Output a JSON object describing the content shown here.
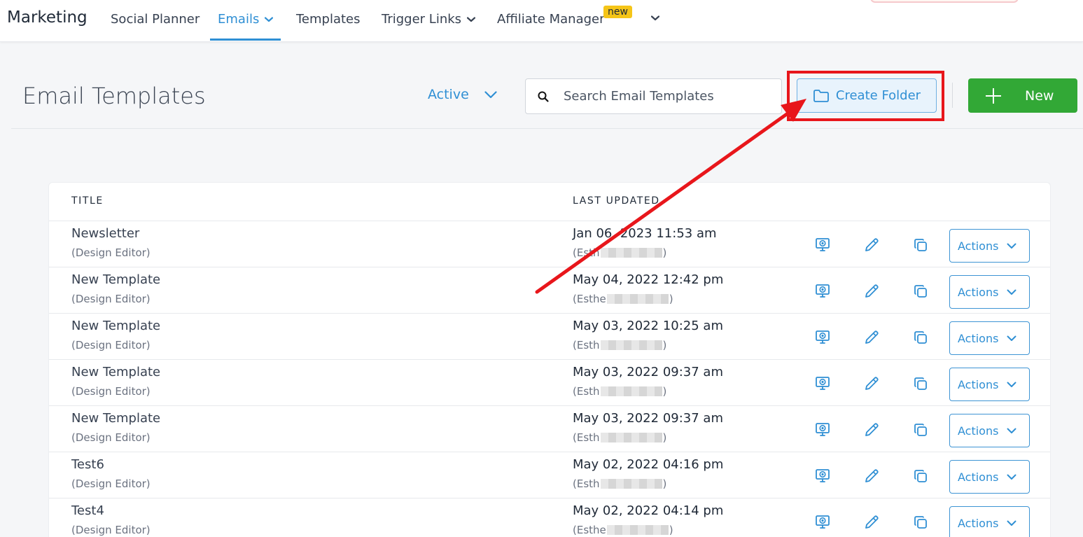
{
  "header": {
    "brand": "Marketing",
    "nav": [
      {
        "label": "Social Planner",
        "active": false,
        "has_dropdown": false
      },
      {
        "label": "Emails",
        "active": true,
        "has_dropdown": true
      },
      {
        "label": "Templates",
        "active": false,
        "has_dropdown": false
      },
      {
        "label": "Trigger Links",
        "active": false,
        "has_dropdown": true
      },
      {
        "label": "Affiliate Manager",
        "active": false,
        "has_dropdown": false
      }
    ],
    "new_badge": "new",
    "more_icon": "chevron-down-icon"
  },
  "toolbar": {
    "page_title": "Email Templates",
    "status_filter": "Active",
    "search_placeholder": "Search Email Templates",
    "create_folder_label": "Create Folder",
    "new_label": "New"
  },
  "table": {
    "columns": [
      "TITLE",
      "LAST UPDATED"
    ],
    "rows": [
      {
        "title": "Newsletter",
        "editor": "(Design Editor)",
        "updated": "Jan 06, 2023 11:53 am",
        "by_prefix": "(Esth",
        "by_suffix": ")"
      },
      {
        "title": "New Template",
        "editor": "(Design Editor)",
        "updated": "May 04, 2022 12:42 pm",
        "by_prefix": "(Esthe",
        "by_suffix": ")"
      },
      {
        "title": "New Template",
        "editor": "(Design Editor)",
        "updated": "May 03, 2022 10:25 am",
        "by_prefix": "(Esth",
        "by_suffix": ")"
      },
      {
        "title": "New Template",
        "editor": "(Design Editor)",
        "updated": "May 03, 2022 09:37 am",
        "by_prefix": "(Esth",
        "by_suffix": ")"
      },
      {
        "title": "New Template",
        "editor": "(Design Editor)",
        "updated": "May 03, 2022 09:37 am",
        "by_prefix": "(Esth",
        "by_suffix": ")"
      },
      {
        "title": "Test6",
        "editor": "(Design Editor)",
        "updated": "May 02, 2022 04:16 pm",
        "by_prefix": "(Esth",
        "by_suffix": ")"
      },
      {
        "title": "Test4",
        "editor": "(Design Editor)",
        "updated": "May 02, 2022 04:14 pm",
        "by_prefix": "(Esthe",
        "by_suffix": ")"
      }
    ],
    "actions_label": "Actions"
  },
  "colors": {
    "accent": "#2f8fd4",
    "new_button": "#32a836",
    "annotation_red": "#e8161b",
    "badge_yellow": "#f5c518"
  }
}
